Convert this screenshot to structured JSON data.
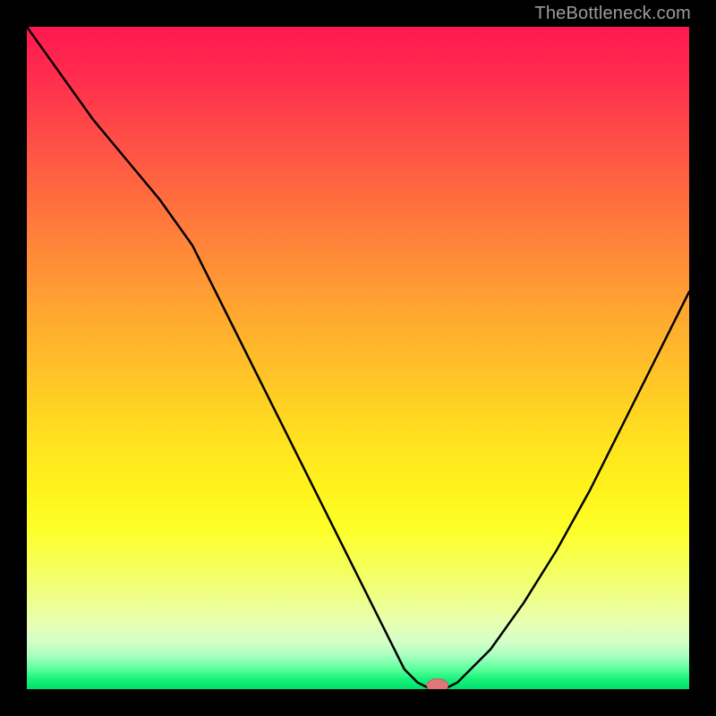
{
  "watermark": "TheBottleneck.com",
  "colors": {
    "page_bg": "#000000",
    "curve": "#000000",
    "marker_fill": "#e2777b",
    "marker_stroke": "#c95a5e",
    "watermark": "#9b9b9b",
    "gradient_top": "#ff1850",
    "gradient_mid": "#ffd321",
    "gradient_bottom": "#00e06e"
  },
  "chart_data": {
    "type": "line",
    "title": "",
    "xlabel": "",
    "ylabel": "",
    "xlim": [
      0,
      100
    ],
    "ylim": [
      0,
      100
    ],
    "grid": false,
    "legend": false,
    "series": [
      {
        "name": "curve",
        "x": [
          0,
          5,
          10,
          15,
          20,
          25,
          30,
          35,
          40,
          45,
          50,
          55,
          57,
          59,
          61,
          63,
          65,
          70,
          75,
          80,
          85,
          90,
          95,
          100
        ],
        "y": [
          100,
          93,
          86,
          80,
          74,
          67,
          57,
          47,
          37,
          27,
          17,
          7,
          3,
          1,
          0,
          0,
          1,
          6,
          13,
          21,
          30,
          40,
          50,
          60
        ]
      }
    ],
    "marker": {
      "x": 62,
      "y": 0,
      "rx": 1.6,
      "ry": 1.0
    }
  }
}
